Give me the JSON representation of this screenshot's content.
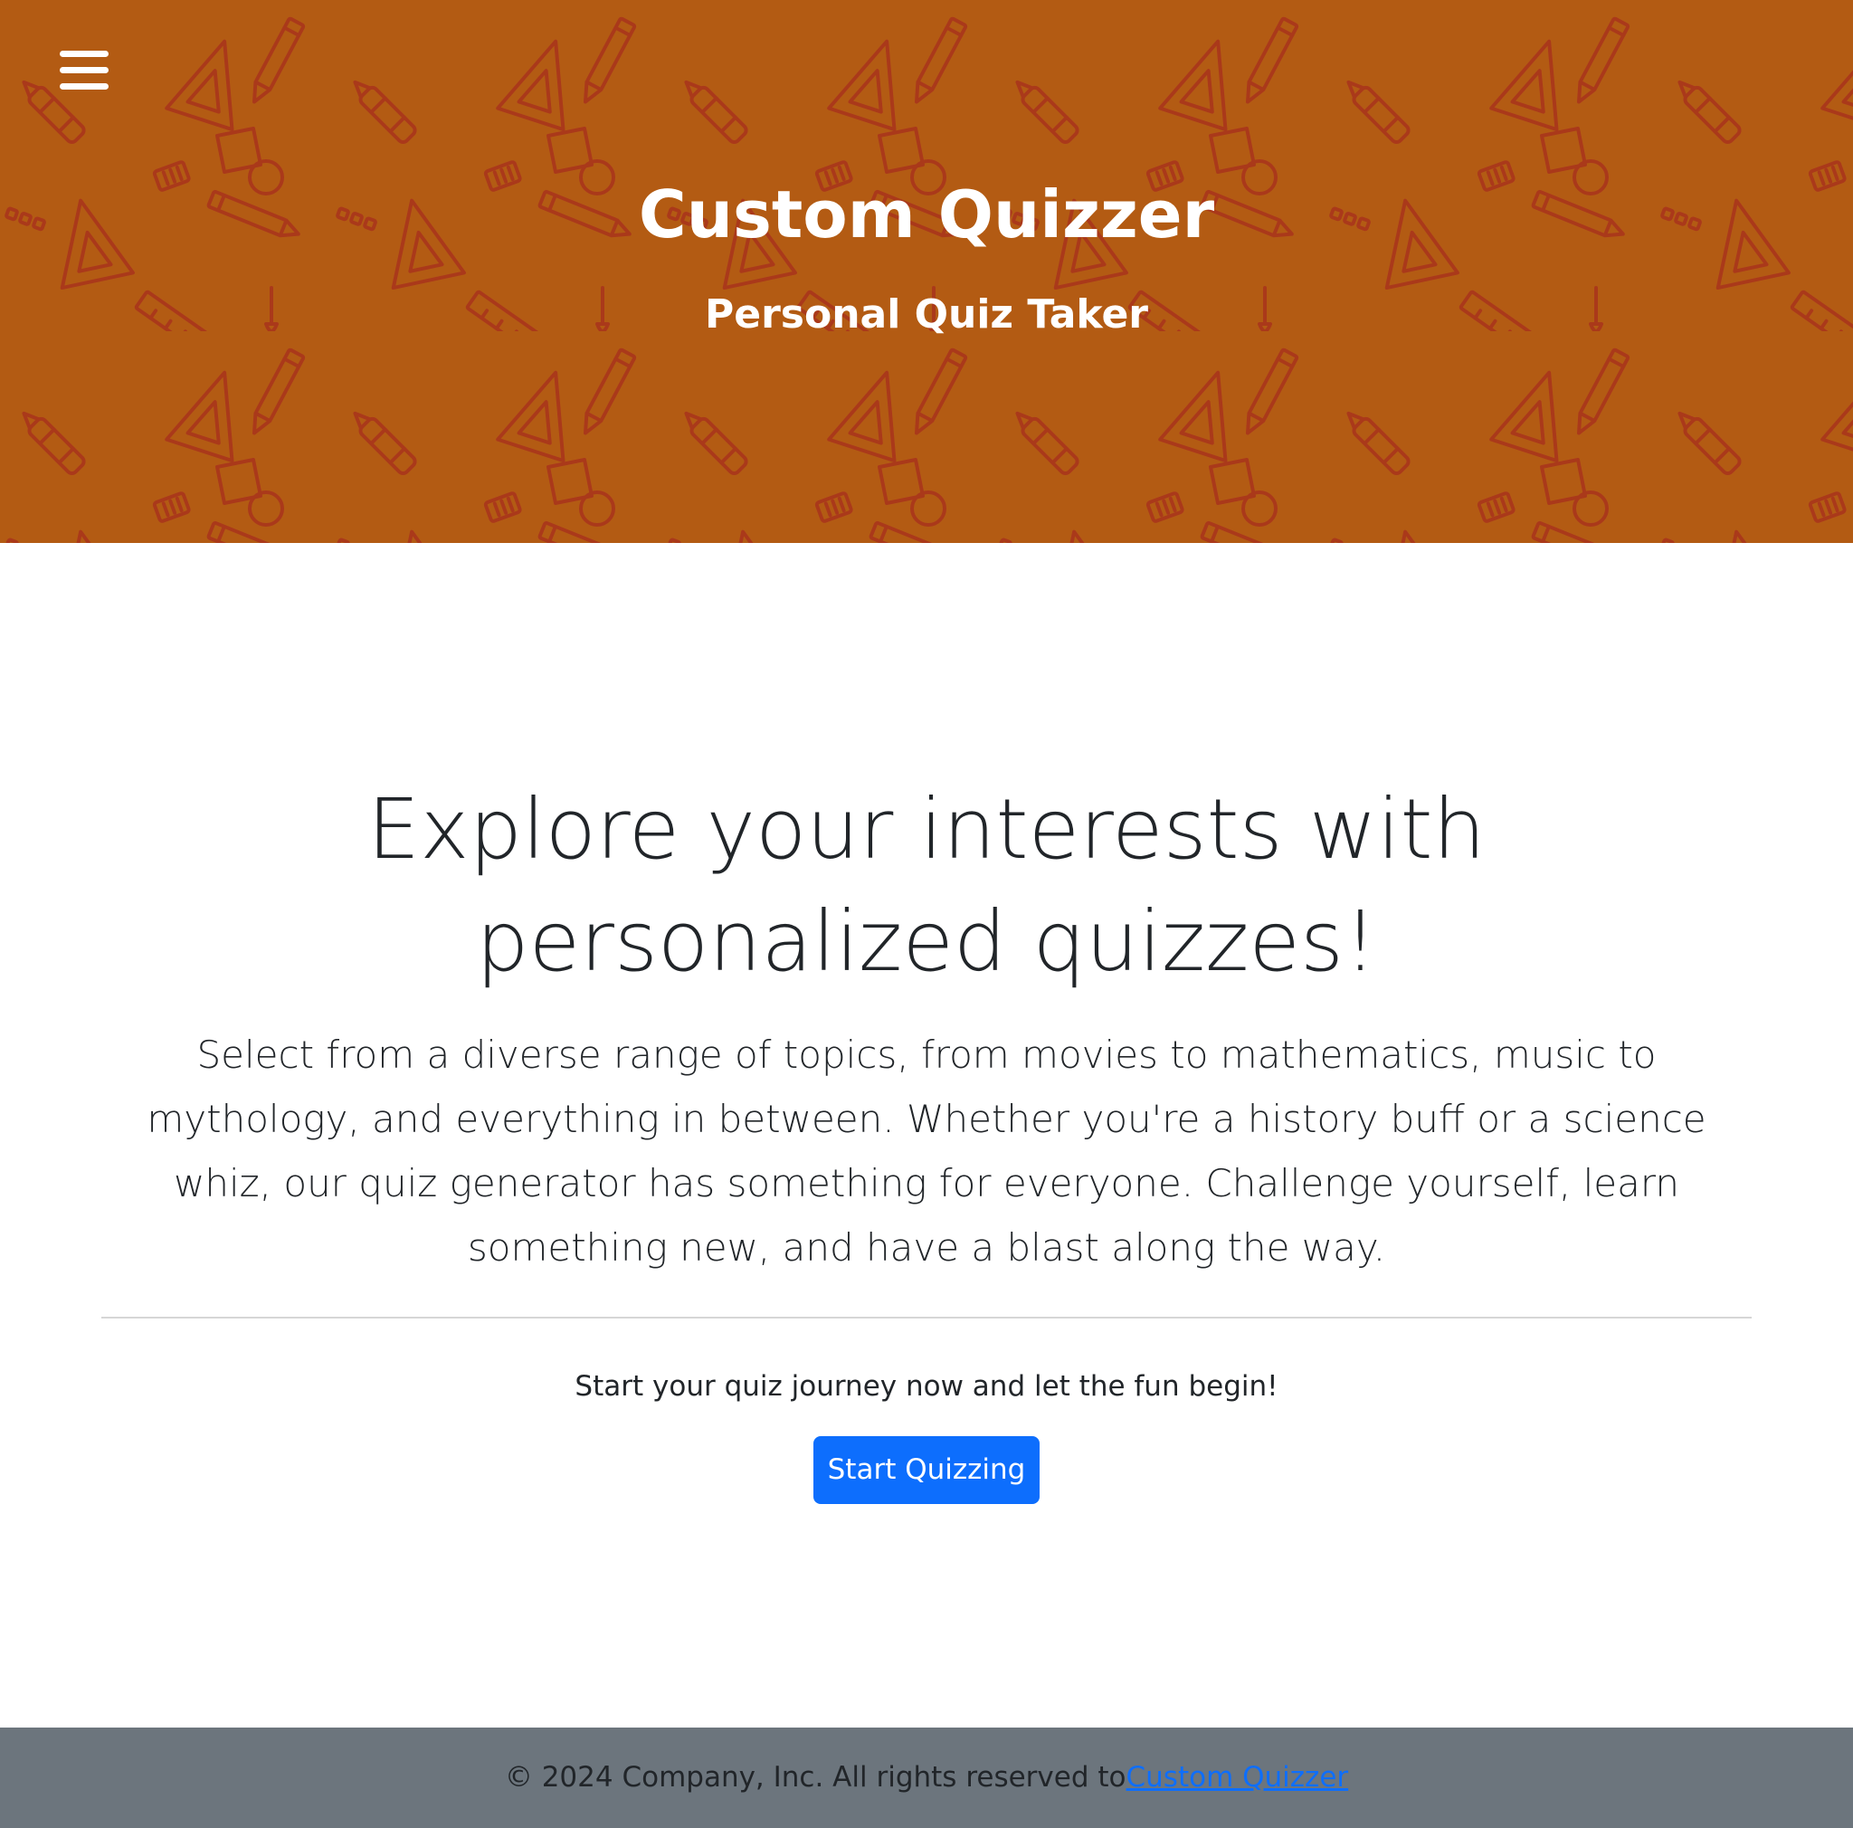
{
  "header": {
    "menu_icon": "hamburger-menu-icon",
    "title": "Custom Quizzer",
    "subtitle": "Personal Quiz Taker",
    "background_color": "#b35b13",
    "pattern_color": "#b0261c",
    "pattern_icons": [
      "pencil-icon",
      "triangle-ruler-icon",
      "ruler-icon",
      "crayon-icon",
      "eraser-icon",
      "paintbrush-icon",
      "shapes-icon"
    ]
  },
  "main": {
    "heading": "Explore your interests with personalized quizzes!",
    "lead": "Select from a diverse range of topics, from movies to mathematics, music to mythology, and everything in between. Whether you're a history buff or a science whiz, our quiz generator has something for everyone. Challenge yourself, learn something new, and have a blast along the way.",
    "cta_text": "Start your quiz journey now and let the fun begin!",
    "start_button_label": "Start Quizzing",
    "button_color": "#0d6efd"
  },
  "footer": {
    "text": "© 2024 Company, Inc. All rights reserved to",
    "link_text": "Custom Quizzer",
    "background_color": "#6c757d",
    "link_color": "#0d6efd"
  }
}
